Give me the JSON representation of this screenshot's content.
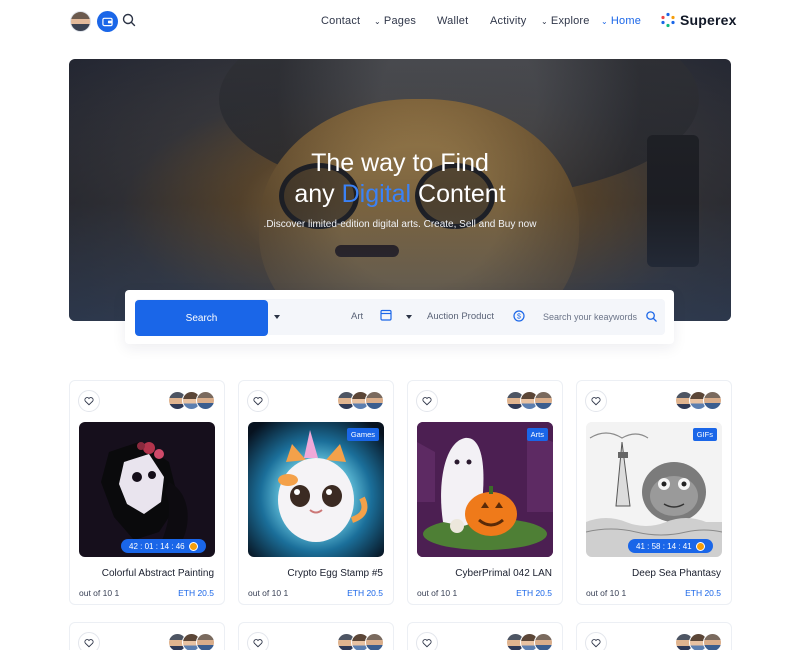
{
  "header": {
    "nav": [
      {
        "label": "Contact",
        "has_dropdown": false,
        "active": false
      },
      {
        "label": "Pages",
        "has_dropdown": true,
        "active": false
      },
      {
        "label": "Wallet",
        "has_dropdown": false,
        "active": false
      },
      {
        "label": "Activity",
        "has_dropdown": false,
        "active": false
      },
      {
        "label": "Explore",
        "has_dropdown": true,
        "active": false
      },
      {
        "label": "Home",
        "has_dropdown": true,
        "active": true
      }
    ],
    "brand": "Superex"
  },
  "hero": {
    "title_line1": "The way to Find",
    "title_prefix": "any ",
    "title_accent": "Digital",
    "title_suffix": " Content",
    "subtitle": ".Discover limited-edition digital arts. Create, Sell and Buy now"
  },
  "search_bar": {
    "button_label": "Search",
    "category": "Art",
    "type": "Auction Product",
    "placeholder": "Search your keaywords"
  },
  "cards": [
    {
      "title": "Colorful Abstract Painting",
      "supply": "out of 10 1",
      "price": "ETH 20.5",
      "tag": "",
      "timer": "42 : 01 : 14 : 46"
    },
    {
      "title": "Crypto Egg Stamp #5",
      "supply": "out of 10 1",
      "price": "ETH 20.5",
      "tag": "Games",
      "timer": ""
    },
    {
      "title": "CyberPrimal 042 LAN",
      "supply": "out of 10 1",
      "price": "ETH 20.5",
      "tag": "Arts",
      "timer": ""
    },
    {
      "title": "Deep Sea Phantasy",
      "supply": "out of 10 1",
      "price": "ETH 20.5",
      "tag": "GIFs",
      "timer": "41 : 58 : 14 : 41"
    }
  ],
  "colors": {
    "accent": "#1a66e8",
    "timer_icon": "#f59e0b"
  }
}
